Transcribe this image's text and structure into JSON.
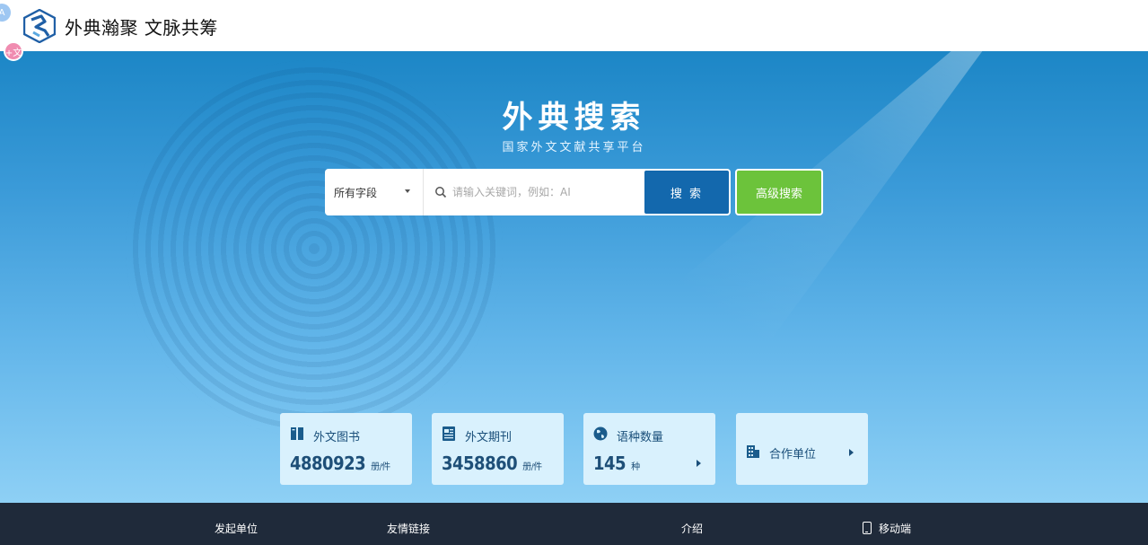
{
  "header": {
    "site_title": "外典瀚聚 文脉共筹",
    "badge_a": "A",
    "badge_t": "+文"
  },
  "hero": {
    "title": "外典搜索",
    "subtitle": "国家外文文献共享平台"
  },
  "search": {
    "field_selected": "所有字段",
    "placeholder": "请输入关键词，例如：AI",
    "search_label": "搜 索",
    "advanced_label": "高级搜索"
  },
  "stats": [
    {
      "label": "外文图书",
      "value": "4880923",
      "unit": "册/件",
      "icon": "book-icon"
    },
    {
      "label": "外文期刊",
      "value": "3458860",
      "unit": "册/件",
      "icon": "journal-icon"
    },
    {
      "label": "语种数量",
      "value": "145",
      "unit": "种",
      "icon": "globe-icon"
    },
    {
      "label": "合作单位",
      "icon": "building-icon"
    }
  ],
  "footer": {
    "item1": "发起单位",
    "item2": "友情链接",
    "item3": "介绍",
    "item4": "移动端"
  },
  "colors": {
    "primary_blue": "#1368ad",
    "green": "#6cc33b",
    "footer_bg": "#1f2a3a",
    "card_bg": "#d9f1fd"
  }
}
